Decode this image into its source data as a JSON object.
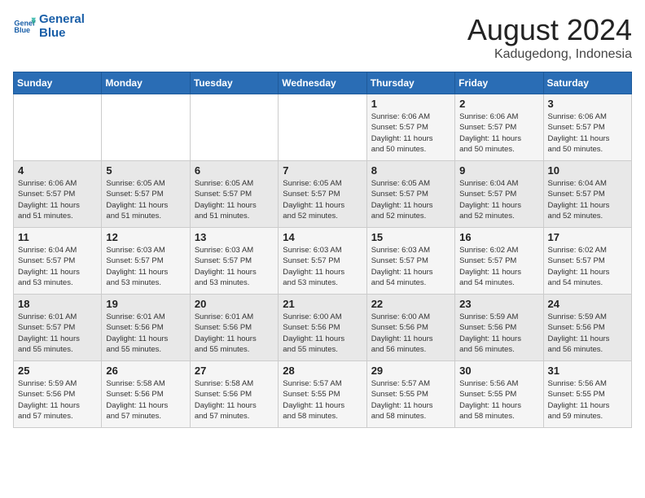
{
  "header": {
    "logo_line1": "General",
    "logo_line2": "Blue",
    "title": "August 2024",
    "subtitle": "Kadugedong, Indonesia"
  },
  "weekdays": [
    "Sunday",
    "Monday",
    "Tuesday",
    "Wednesday",
    "Thursday",
    "Friday",
    "Saturday"
  ],
  "weeks": [
    [
      {
        "day": "",
        "info": ""
      },
      {
        "day": "",
        "info": ""
      },
      {
        "day": "",
        "info": ""
      },
      {
        "day": "",
        "info": ""
      },
      {
        "day": "1",
        "info": "Sunrise: 6:06 AM\nSunset: 5:57 PM\nDaylight: 11 hours\nand 50 minutes."
      },
      {
        "day": "2",
        "info": "Sunrise: 6:06 AM\nSunset: 5:57 PM\nDaylight: 11 hours\nand 50 minutes."
      },
      {
        "day": "3",
        "info": "Sunrise: 6:06 AM\nSunset: 5:57 PM\nDaylight: 11 hours\nand 50 minutes."
      }
    ],
    [
      {
        "day": "4",
        "info": "Sunrise: 6:06 AM\nSunset: 5:57 PM\nDaylight: 11 hours\nand 51 minutes."
      },
      {
        "day": "5",
        "info": "Sunrise: 6:05 AM\nSunset: 5:57 PM\nDaylight: 11 hours\nand 51 minutes."
      },
      {
        "day": "6",
        "info": "Sunrise: 6:05 AM\nSunset: 5:57 PM\nDaylight: 11 hours\nand 51 minutes."
      },
      {
        "day": "7",
        "info": "Sunrise: 6:05 AM\nSunset: 5:57 PM\nDaylight: 11 hours\nand 52 minutes."
      },
      {
        "day": "8",
        "info": "Sunrise: 6:05 AM\nSunset: 5:57 PM\nDaylight: 11 hours\nand 52 minutes."
      },
      {
        "day": "9",
        "info": "Sunrise: 6:04 AM\nSunset: 5:57 PM\nDaylight: 11 hours\nand 52 minutes."
      },
      {
        "day": "10",
        "info": "Sunrise: 6:04 AM\nSunset: 5:57 PM\nDaylight: 11 hours\nand 52 minutes."
      }
    ],
    [
      {
        "day": "11",
        "info": "Sunrise: 6:04 AM\nSunset: 5:57 PM\nDaylight: 11 hours\nand 53 minutes."
      },
      {
        "day": "12",
        "info": "Sunrise: 6:03 AM\nSunset: 5:57 PM\nDaylight: 11 hours\nand 53 minutes."
      },
      {
        "day": "13",
        "info": "Sunrise: 6:03 AM\nSunset: 5:57 PM\nDaylight: 11 hours\nand 53 minutes."
      },
      {
        "day": "14",
        "info": "Sunrise: 6:03 AM\nSunset: 5:57 PM\nDaylight: 11 hours\nand 53 minutes."
      },
      {
        "day": "15",
        "info": "Sunrise: 6:03 AM\nSunset: 5:57 PM\nDaylight: 11 hours\nand 54 minutes."
      },
      {
        "day": "16",
        "info": "Sunrise: 6:02 AM\nSunset: 5:57 PM\nDaylight: 11 hours\nand 54 minutes."
      },
      {
        "day": "17",
        "info": "Sunrise: 6:02 AM\nSunset: 5:57 PM\nDaylight: 11 hours\nand 54 minutes."
      }
    ],
    [
      {
        "day": "18",
        "info": "Sunrise: 6:01 AM\nSunset: 5:57 PM\nDaylight: 11 hours\nand 55 minutes."
      },
      {
        "day": "19",
        "info": "Sunrise: 6:01 AM\nSunset: 5:56 PM\nDaylight: 11 hours\nand 55 minutes."
      },
      {
        "day": "20",
        "info": "Sunrise: 6:01 AM\nSunset: 5:56 PM\nDaylight: 11 hours\nand 55 minutes."
      },
      {
        "day": "21",
        "info": "Sunrise: 6:00 AM\nSunset: 5:56 PM\nDaylight: 11 hours\nand 55 minutes."
      },
      {
        "day": "22",
        "info": "Sunrise: 6:00 AM\nSunset: 5:56 PM\nDaylight: 11 hours\nand 56 minutes."
      },
      {
        "day": "23",
        "info": "Sunrise: 5:59 AM\nSunset: 5:56 PM\nDaylight: 11 hours\nand 56 minutes."
      },
      {
        "day": "24",
        "info": "Sunrise: 5:59 AM\nSunset: 5:56 PM\nDaylight: 11 hours\nand 56 minutes."
      }
    ],
    [
      {
        "day": "25",
        "info": "Sunrise: 5:59 AM\nSunset: 5:56 PM\nDaylight: 11 hours\nand 57 minutes."
      },
      {
        "day": "26",
        "info": "Sunrise: 5:58 AM\nSunset: 5:56 PM\nDaylight: 11 hours\nand 57 minutes."
      },
      {
        "day": "27",
        "info": "Sunrise: 5:58 AM\nSunset: 5:56 PM\nDaylight: 11 hours\nand 57 minutes."
      },
      {
        "day": "28",
        "info": "Sunrise: 5:57 AM\nSunset: 5:55 PM\nDaylight: 11 hours\nand 58 minutes."
      },
      {
        "day": "29",
        "info": "Sunrise: 5:57 AM\nSunset: 5:55 PM\nDaylight: 11 hours\nand 58 minutes."
      },
      {
        "day": "30",
        "info": "Sunrise: 5:56 AM\nSunset: 5:55 PM\nDaylight: 11 hours\nand 58 minutes."
      },
      {
        "day": "31",
        "info": "Sunrise: 5:56 AM\nSunset: 5:55 PM\nDaylight: 11 hours\nand 59 minutes."
      }
    ]
  ]
}
